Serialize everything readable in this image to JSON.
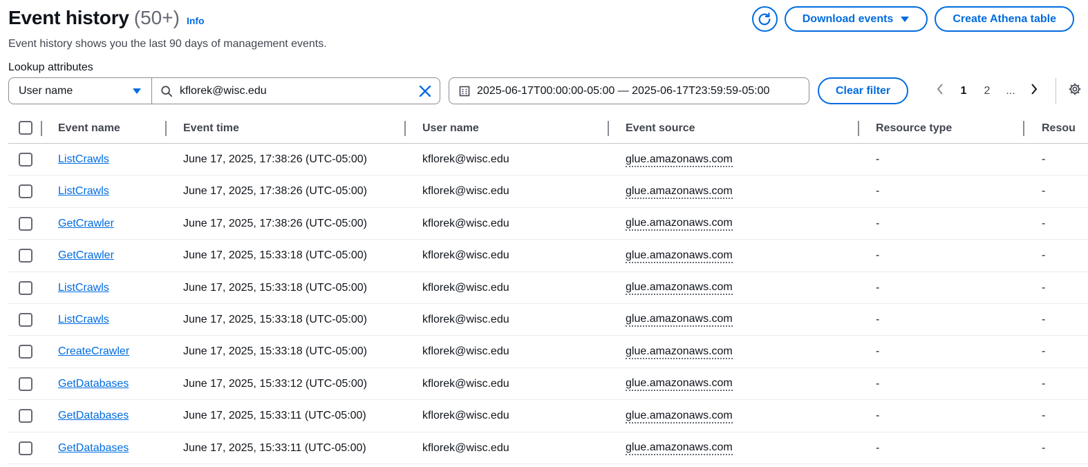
{
  "header": {
    "title": "Event history",
    "count": "(50+)",
    "info": "Info",
    "description": "Event history shows you the last 90 days of management events.",
    "download_label": "Download events",
    "athena_label": "Create Athena table"
  },
  "filter": {
    "lookup_label": "Lookup attributes",
    "attribute": "User name",
    "search_value": "kflorek@wisc.edu",
    "date_range": "2025-06-17T00:00:00-05:00 — 2025-06-17T23:59:59-05:00",
    "clear_label": "Clear filter"
  },
  "pagination": {
    "pages": [
      "1",
      "2",
      "..."
    ]
  },
  "table": {
    "columns": [
      "Event name",
      "Event time",
      "User name",
      "Event source",
      "Resource type",
      "Resou"
    ],
    "rows": [
      {
        "event_name": "ListCrawls",
        "event_time": "June 17, 2025, 17:38:26 (UTC-05:00)",
        "user_name": "kflorek@wisc.edu",
        "event_source": "glue.amazonaws.com",
        "resource_type": "-",
        "resource_name": "-"
      },
      {
        "event_name": "ListCrawls",
        "event_time": "June 17, 2025, 17:38:26 (UTC-05:00)",
        "user_name": "kflorek@wisc.edu",
        "event_source": "glue.amazonaws.com",
        "resource_type": "-",
        "resource_name": "-"
      },
      {
        "event_name": "GetCrawler",
        "event_time": "June 17, 2025, 17:38:26 (UTC-05:00)",
        "user_name": "kflorek@wisc.edu",
        "event_source": "glue.amazonaws.com",
        "resource_type": "-",
        "resource_name": "-"
      },
      {
        "event_name": "GetCrawler",
        "event_time": "June 17, 2025, 15:33:18 (UTC-05:00)",
        "user_name": "kflorek@wisc.edu",
        "event_source": "glue.amazonaws.com",
        "resource_type": "-",
        "resource_name": "-"
      },
      {
        "event_name": "ListCrawls",
        "event_time": "June 17, 2025, 15:33:18 (UTC-05:00)",
        "user_name": "kflorek@wisc.edu",
        "event_source": "glue.amazonaws.com",
        "resource_type": "-",
        "resource_name": "-"
      },
      {
        "event_name": "ListCrawls",
        "event_time": "June 17, 2025, 15:33:18 (UTC-05:00)",
        "user_name": "kflorek@wisc.edu",
        "event_source": "glue.amazonaws.com",
        "resource_type": "-",
        "resource_name": "-"
      },
      {
        "event_name": "CreateCrawler",
        "event_time": "June 17, 2025, 15:33:18 (UTC-05:00)",
        "user_name": "kflorek@wisc.edu",
        "event_source": "glue.amazonaws.com",
        "resource_type": "-",
        "resource_name": "-"
      },
      {
        "event_name": "GetDatabases",
        "event_time": "June 17, 2025, 15:33:12 (UTC-05:00)",
        "user_name": "kflorek@wisc.edu",
        "event_source": "glue.amazonaws.com",
        "resource_type": "-",
        "resource_name": "-"
      },
      {
        "event_name": "GetDatabases",
        "event_time": "June 17, 2025, 15:33:11 (UTC-05:00)",
        "user_name": "kflorek@wisc.edu",
        "event_source": "glue.amazonaws.com",
        "resource_type": "-",
        "resource_name": "-"
      },
      {
        "event_name": "GetDatabases",
        "event_time": "June 17, 2025, 15:33:11 (UTC-05:00)",
        "user_name": "kflorek@wisc.edu",
        "event_source": "glue.amazonaws.com",
        "resource_type": "-",
        "resource_name": "-"
      }
    ]
  },
  "icons": {
    "refresh": "refresh-icon",
    "dropdown": "caret-down-icon",
    "search": "search-icon",
    "clear": "close-icon",
    "calendar": "calendar-icon",
    "prev": "chevron-left-icon",
    "next": "chevron-right-icon",
    "settings": "gear-icon"
  },
  "colors": {
    "accent": "#006ce0",
    "text": "#0f141a",
    "muted": "#656871"
  }
}
